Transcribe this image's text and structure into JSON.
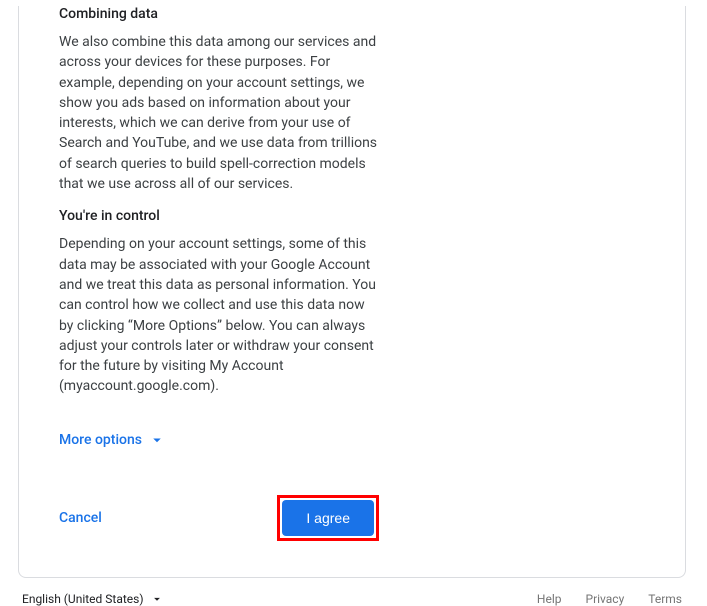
{
  "sections": {
    "combining": {
      "heading": "Combining data",
      "body": "We also combine this data among our services and across your devices for these purposes. For example, depending on your account settings, we show you ads based on information about your interests, which we can derive from your use of Search and YouTube, and we use data from trillions of search queries to build spell-correction models that we use across all of our services."
    },
    "control": {
      "heading": "You're in control",
      "body": "Depending on your account settings, some of this data may be associated with your Google Account and we treat this data as personal information. You can control how we collect and use this data now by clicking “More Options” below. You can always adjust your controls later or withdraw your consent for the future by visiting My Account (myaccount.google.com)."
    }
  },
  "more_options_label": "More options",
  "actions": {
    "cancel": "Cancel",
    "agree": "I agree"
  },
  "footer": {
    "language": "English (United States)",
    "links": {
      "help": "Help",
      "privacy": "Privacy",
      "terms": "Terms"
    }
  }
}
